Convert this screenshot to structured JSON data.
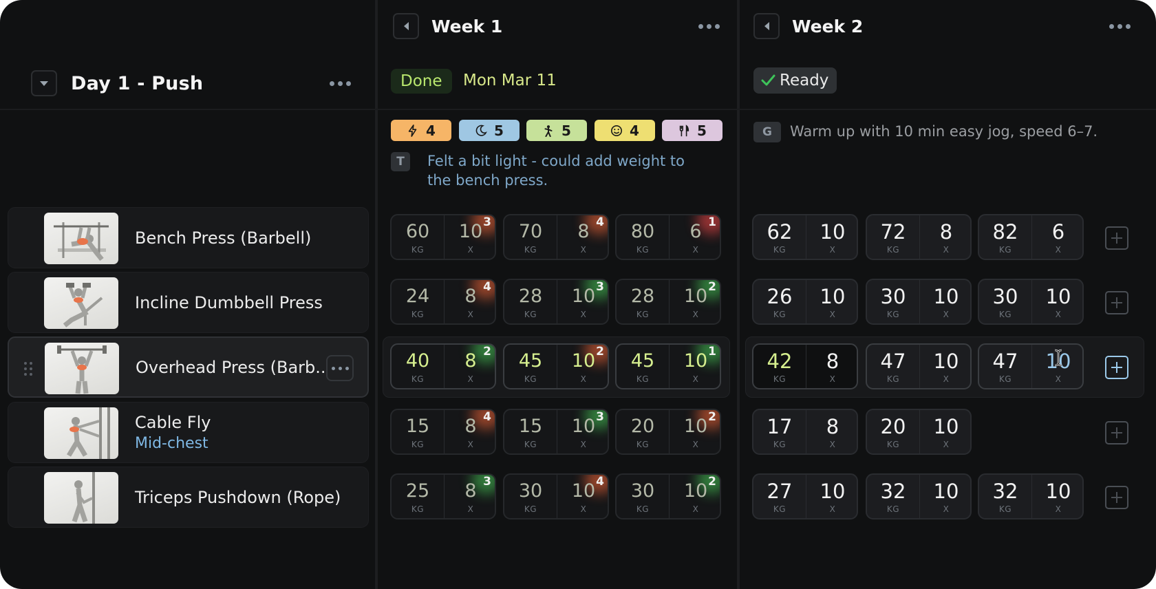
{
  "workout": {
    "day_title": "Day 1 - Push"
  },
  "exercises": [
    {
      "name": "Bench Press (Barbell)",
      "sub": ""
    },
    {
      "name": "Incline Dumbbell Press",
      "sub": ""
    },
    {
      "name": "Overhead Press (Barb..",
      "sub": ""
    },
    {
      "name": "Cable Fly",
      "sub": "Mid-chest"
    },
    {
      "name": "Triceps Pushdown (Rope)",
      "sub": ""
    }
  ],
  "selected_exercise_index": 2,
  "weeks": [
    {
      "title": "Week 1",
      "status": "Done",
      "date": "Mon Mar 11",
      "ratings": [
        {
          "icon": "bolt-icon",
          "value": "4",
          "color": "#f6b567"
        },
        {
          "icon": "moon-icon",
          "value": "5",
          "color": "#9fc7e3"
        },
        {
          "icon": "person-icon",
          "value": "5",
          "color": "#c6e19a"
        },
        {
          "icon": "smile-icon",
          "value": "4",
          "color": "#eedf72"
        },
        {
          "icon": "fork-knife-icon",
          "value": "5",
          "color": "#ddc7de"
        }
      ],
      "note": {
        "letter": "T",
        "text": "Felt a bit light - could add weight to the bench press.",
        "color": "#7fa8c9"
      },
      "sets": [
        [
          {
            "kg": "60",
            "reps": "10",
            "rpe": "3",
            "glow": "#ff6a3a"
          },
          {
            "kg": "70",
            "reps": "8",
            "rpe": "4",
            "glow": "#ff6a3a"
          },
          {
            "kg": "80",
            "reps": "6",
            "rpe": "1",
            "glow": "#ff4a4a"
          }
        ],
        [
          {
            "kg": "24",
            "reps": "8",
            "rpe": "4",
            "glow": "#ff6a3a"
          },
          {
            "kg": "28",
            "reps": "10",
            "rpe": "3",
            "glow": "#4ad05a"
          },
          {
            "kg": "28",
            "reps": "10",
            "rpe": "2",
            "glow": "#4ad05a"
          }
        ],
        [
          {
            "kg": "40",
            "reps": "8",
            "rpe": "2",
            "glow": "#4ad05a"
          },
          {
            "kg": "45",
            "reps": "10",
            "rpe": "2",
            "glow": "#ff6a3a"
          },
          {
            "kg": "45",
            "reps": "10",
            "rpe": "1",
            "glow": "#4ad05a"
          }
        ],
        [
          {
            "kg": "15",
            "reps": "8",
            "rpe": "4",
            "glow": "#ff6a3a"
          },
          {
            "kg": "15",
            "reps": "10",
            "rpe": "3",
            "glow": "#4ad05a"
          },
          {
            "kg": "20",
            "reps": "10",
            "rpe": "2",
            "glow": "#ff6a3a"
          }
        ],
        [
          {
            "kg": "25",
            "reps": "8",
            "rpe": "3",
            "glow": "#4ad05a"
          },
          {
            "kg": "30",
            "reps": "10",
            "rpe": "4",
            "glow": "#ff6a3a"
          },
          {
            "kg": "30",
            "reps": "10",
            "rpe": "2",
            "glow": "#4ad05a"
          }
        ]
      ]
    },
    {
      "title": "Week 2",
      "status": "Ready",
      "note": {
        "letter": "G",
        "text": "Warm up with 10 min easy jog, speed 6–7.",
        "color": "#9b9ea2"
      },
      "sets": [
        [
          {
            "kg": "62",
            "reps": "10"
          },
          {
            "kg": "72",
            "reps": "8"
          },
          {
            "kg": "82",
            "reps": "6"
          }
        ],
        [
          {
            "kg": "26",
            "reps": "10"
          },
          {
            "kg": "30",
            "reps": "10"
          },
          {
            "kg": "30",
            "reps": "10"
          }
        ],
        [
          {
            "kg": "42",
            "reps": "8"
          },
          {
            "kg": "47",
            "reps": "10"
          },
          {
            "kg": "47",
            "reps": "10"
          }
        ],
        [
          {
            "kg": "17",
            "reps": "8"
          },
          {
            "kg": "20",
            "reps": "10"
          }
        ],
        [
          {
            "kg": "27",
            "reps": "10"
          },
          {
            "kg": "32",
            "reps": "10"
          },
          {
            "kg": "32",
            "reps": "10"
          }
        ]
      ]
    }
  ],
  "units": {
    "weight": "KG",
    "reps": "X"
  },
  "colors": {
    "accent_green": "#b9e86e",
    "accent_blue": "#9bc9ea",
    "check_green": "#3ec45a"
  }
}
